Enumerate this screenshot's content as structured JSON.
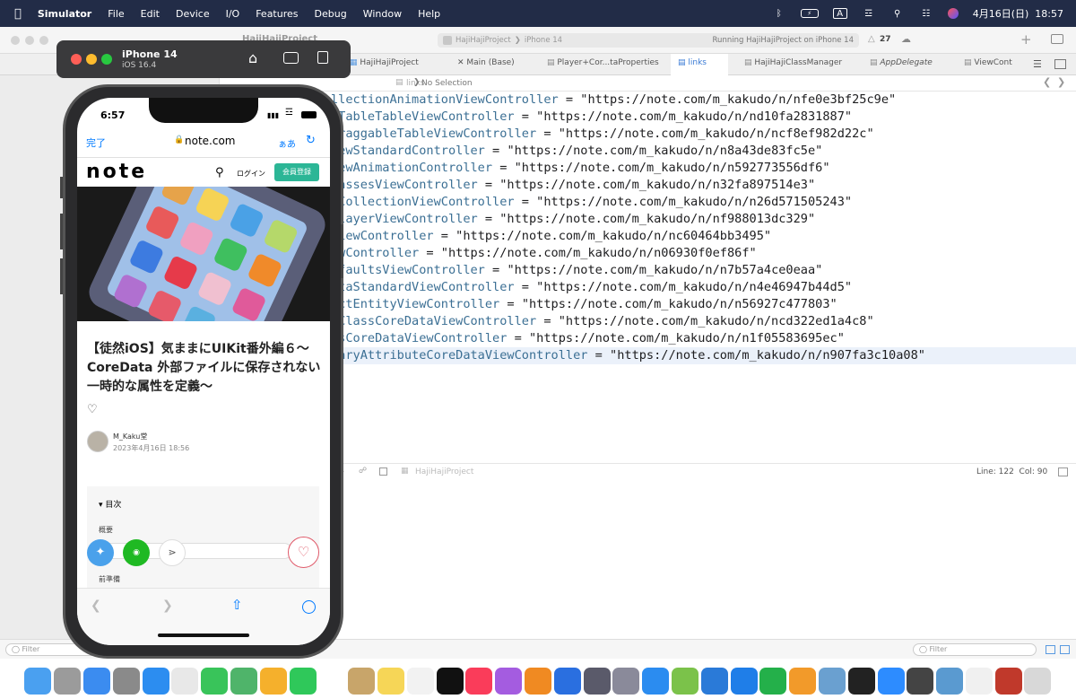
{
  "menubar": {
    "apple": "",
    "items": [
      "Simulator",
      "File",
      "Edit",
      "Device",
      "I/O",
      "Features",
      "Debug",
      "Window",
      "Help"
    ],
    "input_indicator": "A",
    "datetime": "4月16日(日)  18:57"
  },
  "xcode": {
    "project_title": "HajiHajiProject",
    "scheme": "HajiHajiProject",
    "destination": "iPhone 14",
    "status": "Running HajiHajiProject on iPhone 14",
    "warning_count": "27",
    "tabs": [
      "HajiHajiProject",
      "Main (Base)",
      "Player+Cor...taProperties",
      "links",
      "HajiHajiClassManager",
      "AppDelegate",
      "ViewCont"
    ],
    "jump": {
      "file": "links",
      "selection": "No Selection"
    },
    "code_lines": [
      {
        "name": "llectionAnimationViewController",
        "url": "\"https://note.com/m_kakudo/n/nfe0e3bf25c9e\""
      },
      {
        "name": "sTableTableViewController",
        "url": "\"https://note.com/m_kakudo/n/nd10fa2831887\""
      },
      {
        "name": "DraggableTableViewController",
        "url": "\"https://note.com/m_kakudo/n/ncf8ef982d22c\""
      },
      {
        "name": "iewStandardController",
        "url": "\"https://note.com/m_kakudo/n/n8a43de83fc5e\""
      },
      {
        "name": "iewAnimationController",
        "url": "\"https://note.com/m_kakudo/n/n592773556df6\""
      },
      {
        "name": "lassesViewController",
        "url": "\"https://note.com/m_kakudo/n/n32fa897514e3\""
      },
      {
        "name": "tCollectionViewController",
        "url": "\"https://note.com/m_kakudo/n/n26d571505243\""
      },
      {
        "name": "PlayerViewController",
        "url": "\"https://note.com/m_kakudo/n/nf988013dc329\""
      },
      {
        "name": "ViewController",
        "url": "\"https://note.com/m_kakudo/n/nc60464bb3495\""
      },
      {
        "name": "ewController",
        "url": "\"https://note.com/m_kakudo/n/n06930f0ef86f\""
      },
      {
        "name": "efaultsViewController",
        "url": "\"https://note.com/m_kakudo/n/n7b57a4ce0eaa\""
      },
      {
        "name": "ataStandardViewController",
        "url": "\"https://note.com/m_kakudo/n/n4e46947b44d5\""
      },
      {
        "name": "actEntityViewController",
        "url": "\"https://note.com/m_kakudo/n/n56927c477803\""
      },
      {
        "name": "mClassCoreDataViewController",
        "url": "\"https://note.com/m_kakudo/n/ncd322ed1a4c8\""
      },
      {
        "name": "esCoreDataViewController",
        "url": "\"https://note.com/m_kakudo/n/n1f05583695ec\""
      },
      {
        "name": "raryAttributeCoreDataViewController",
        "url": "\"https://note.com/m_kakudo/n/n907fa3c10a08\""
      }
    ],
    "status_project": "HajiHajiProject",
    "cursor": "Line: 122  Col: 90",
    "filter_placeholder": "Filter"
  },
  "simulator": {
    "device": "iPhone 14",
    "os": "iOS 16.4"
  },
  "phone": {
    "time": "6:57",
    "done": "完了",
    "url": "note.com",
    "aa": "ぁあ",
    "logo": "note",
    "login": "ログイン",
    "signup": "会員登録",
    "title": "【徒然iOS】気ままにUIKit番外編６〜CoreData 外部ファイルに保存されない一時的な属性を定義〜",
    "author": "M_Kaku堂",
    "date": "2023年4月16日 18:56",
    "toc_label": "目次",
    "toc_items": [
      "概要",
      "前準備"
    ]
  },
  "colors": {
    "menubar": "#222c47",
    "note_green": "#2cb696",
    "link_blue": "#007aff",
    "code_name": "#3b6f94",
    "highlight": "#ebf1fa"
  },
  "dock": [
    "finder",
    "launchpad",
    "mail",
    "settings",
    "safari",
    "chrome",
    "messages",
    "maps",
    "photos",
    "facetime",
    "calendar",
    "notes-app",
    "notes",
    "reminders",
    "tv",
    "music",
    "podcasts",
    "books",
    "xcode",
    "instruments",
    "simulator-folder",
    "app-store",
    "coteditor",
    "vscode",
    "keynote",
    "numbers",
    "pages",
    "preview",
    "terminal",
    "zoom",
    "calculator",
    "finder2",
    "textedit",
    "kotoeri",
    "trash"
  ]
}
